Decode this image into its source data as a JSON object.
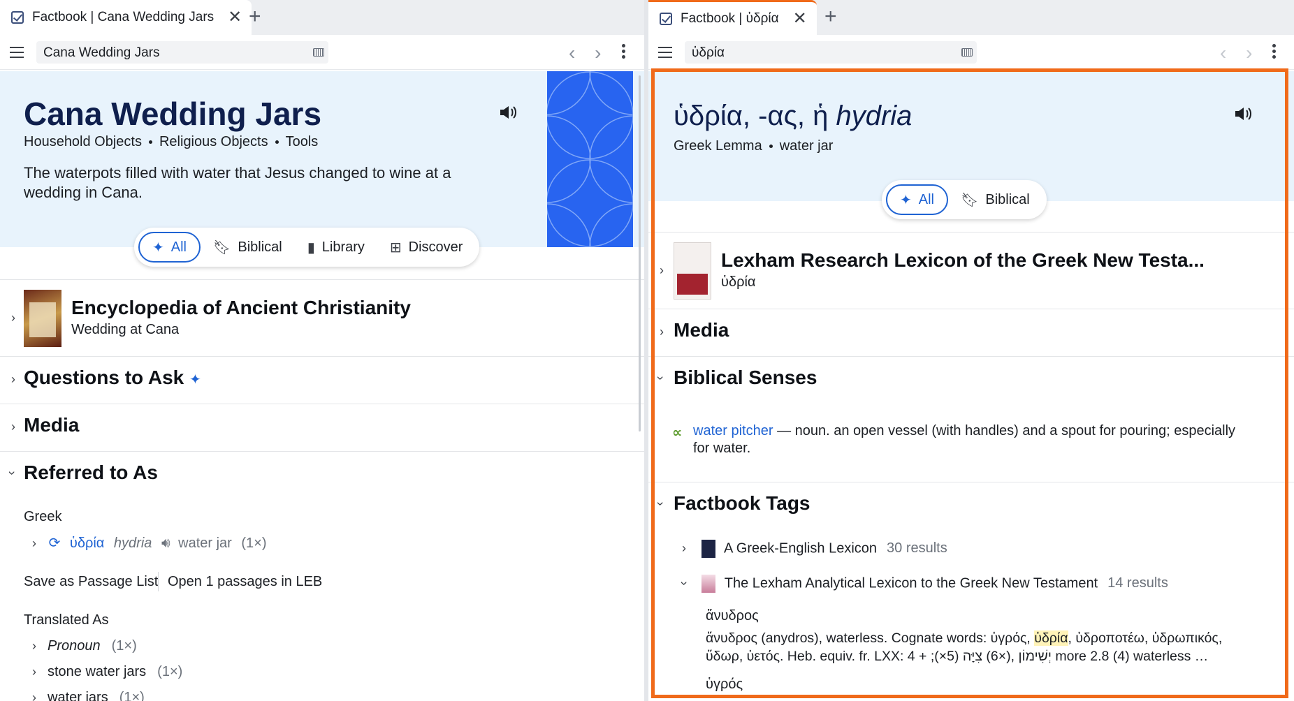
{
  "left": {
    "tab": {
      "title": "Factbook | Cana Wedding Jars",
      "close": "✕",
      "add": "+"
    },
    "address": "Cana Wedding Jars",
    "nav": "‹ ›",
    "hero": {
      "title": "Cana Wedding Jars",
      "categories": [
        "Household Objects",
        "Religious Objects",
        "Tools"
      ],
      "description": "The waterpots filled with water that Jesus changed to wine at a wedding in Cana."
    },
    "filters": [
      "All",
      "Biblical",
      "Library",
      "Discover"
    ],
    "encyclopedia": {
      "title": "Encyclopedia of Ancient Christianity",
      "link": "Wedding at Cana"
    },
    "questions": {
      "title": "Questions to Ask"
    },
    "media": {
      "title": "Media"
    },
    "referred": {
      "title": "Referred to As",
      "greek_label": "Greek",
      "greek_word": "ὑδρία",
      "greek_translit": "hydria",
      "greek_gloss": "water jar",
      "greek_count": "(1×)",
      "save_link": "Save as Passage List",
      "open_link": "Open 1 passages in LEB",
      "translated_label": "Translated As",
      "translated": [
        {
          "text": "Pronoun",
          "count": "(1×)"
        },
        {
          "text": "stone water jars",
          "count": "(1×)"
        },
        {
          "text": "water jars",
          "count": "(1×)"
        }
      ]
    }
  },
  "right": {
    "tab": {
      "title": "Factbook | ὑδρία",
      "close": "✕",
      "add": "+"
    },
    "address": "ὑδρία",
    "nav": "‹ ›",
    "hero": {
      "title_greek": "ὑδρία, -ας, ἡ",
      "title_translit": "hydria",
      "categories": [
        "Greek Lemma",
        "water jar"
      ]
    },
    "filters": [
      "All",
      "Biblical"
    ],
    "lexicon": {
      "title": "Lexham Research Lexicon of the Greek New Testa...",
      "link": "ὑδρία"
    },
    "media": {
      "title": "Media"
    },
    "senses": {
      "title": "Biblical Senses",
      "sense_link": "water pitcher",
      "sense_text": "— noun. an open vessel (with handles) and a spout for pouring; especially for water."
    },
    "tags": {
      "title": "Factbook Tags",
      "items": [
        {
          "title": "A Greek-English Lexicon",
          "count": "30 results"
        },
        {
          "title": "The Lexham Analytical Lexicon to the Greek New Testament",
          "count": "14 results"
        }
      ],
      "entry1_head": "ἄνυδρος",
      "entry1_line1_a": "ἄνυδρος (anydros), waterless. Cognate words: ὑγρός, ",
      "entry1_line1_hl": "ὑδρία",
      "entry1_line1_b": ", ὑδροποτέω, ὑδρωπικός,",
      "entry1_line2": "ὕδωρ, ὑετός. Heb. equiv. fr. LXX: 4 + ;(×5) יְשִׁימוֹן ,(×6) צִיָּה more 2.8 (4) waterless …",
      "entry2_head": "ὑγρός"
    }
  }
}
